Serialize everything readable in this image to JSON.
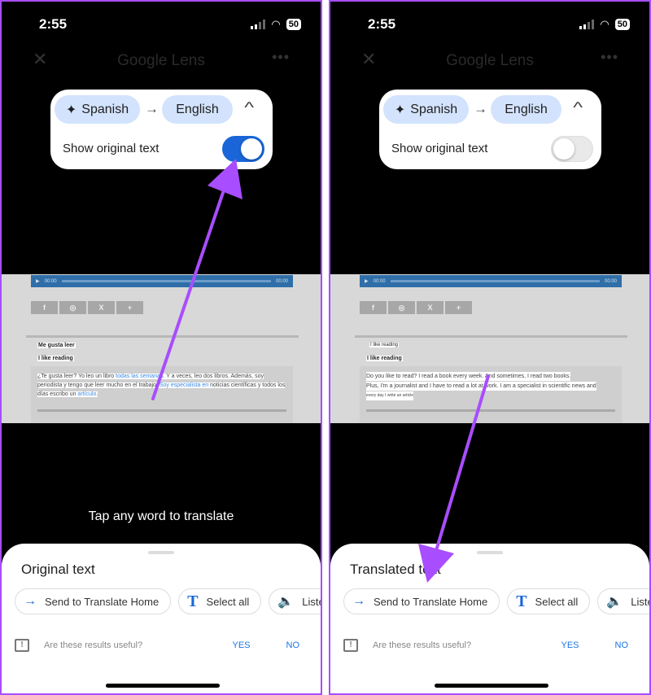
{
  "annotation_color": "#a84dff",
  "panels": [
    {
      "status": {
        "time": "2:55",
        "battery": "50",
        "icons": [
          "signal-icon",
          "wifi-icon",
          "battery-icon"
        ]
      },
      "header": {
        "close": "✕",
        "title": "Google Lens",
        "more": "•••"
      },
      "translate_card": {
        "source_lang": "Spanish",
        "target_lang": "English",
        "arrow": "→",
        "collapse": "^",
        "toggle_label": "Show original text",
        "toggle_on": true
      },
      "web": {
        "audio_start": "00:00",
        "audio_end": "00:00",
        "social": [
          "f",
          "◎",
          "X",
          "+"
        ],
        "heading1": "Me gusta leer",
        "heading1_plain": false,
        "heading2": "I like reading",
        "paragraph_segments": [
          {
            "text": "¿Te gusta leer? Yo leo un libro ",
            "link": false
          },
          {
            "text": "todas las semanas",
            "link": true
          },
          {
            "text": ". Y a veces, leo dos libros. Además, soy periodista y tengo que leer mucho en el trabajo. ",
            "link": false
          },
          {
            "text": "Soy especialista en",
            "link": true
          },
          {
            "text": " noticias científicas y todos los días escribo un ",
            "link": false
          },
          {
            "text": "artículo",
            "link": true
          },
          {
            "text": ".",
            "link": false
          }
        ],
        "paragraph_lines": []
      },
      "hint": "Tap any word to translate",
      "sheet": {
        "title": "Original text",
        "actions": [
          {
            "icon": "→",
            "label": "Send to Translate Home"
          },
          {
            "icon": "T",
            "label": "Select all"
          },
          {
            "icon": "🔈",
            "label": "Listen"
          }
        ],
        "feedback": {
          "question": "Are these results useful?",
          "yes": "YES",
          "no": "NO"
        }
      }
    },
    {
      "status": {
        "time": "2:55",
        "battery": "50",
        "icons": [
          "signal-icon",
          "wifi-icon",
          "battery-icon"
        ]
      },
      "header": {
        "close": "✕",
        "title": "Google Lens",
        "more": "•••"
      },
      "translate_card": {
        "source_lang": "Spanish",
        "target_lang": "English",
        "arrow": "→",
        "collapse": "^",
        "toggle_label": "Show original text",
        "toggle_on": false
      },
      "web": {
        "audio_start": "00:00",
        "audio_end": "00:00",
        "social": [
          "f",
          "◎",
          "X",
          "+"
        ],
        "heading1": "I like reading",
        "heading1_plain": true,
        "heading2": "I like reading",
        "paragraph_segments": [],
        "paragraph_lines": [
          {
            "text": "Do you like to read? I read a book every week. And sometimes, I read two books.",
            "small": false
          },
          {
            "text": "Plus, I'm a journalist and I have to read a lot at work. I am a specialist in scientific news and",
            "small": false
          },
          {
            "text": "every day I write an article",
            "small": true
          }
        ]
      },
      "hint": "",
      "sheet": {
        "title": "Translated text",
        "actions": [
          {
            "icon": "→",
            "label": "Send to Translate Home"
          },
          {
            "icon": "T",
            "label": "Select all"
          },
          {
            "icon": "🔈",
            "label": "Listen"
          }
        ],
        "feedback": {
          "question": "Are these results useful?",
          "yes": "YES",
          "no": "NO"
        }
      }
    }
  ]
}
